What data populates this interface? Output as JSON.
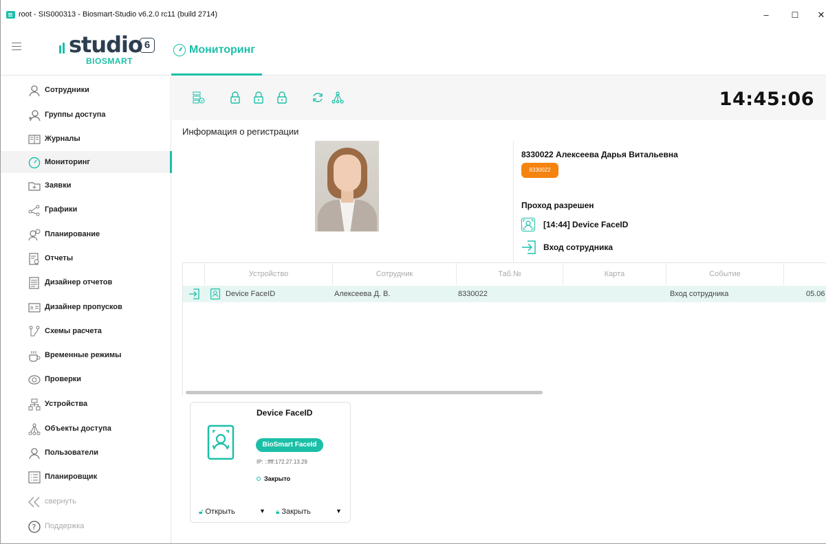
{
  "window": {
    "title": "root - SIS000313 - Biosmart-Studio v6.2.0 rc11 (build 2714)",
    "minimize": "–",
    "maximize": "☐",
    "close": "✕"
  },
  "logo": {
    "word": "studio",
    "version": "6",
    "sub": "BIOSMART"
  },
  "header": {
    "tab_label": "Мониторинг"
  },
  "sidebar": {
    "items": [
      {
        "label": "Сотрудники",
        "icon": "person-icon"
      },
      {
        "label": "Группы доступа",
        "icon": "group-icon"
      },
      {
        "label": "Журналы",
        "icon": "book-icon"
      },
      {
        "label": "Мониторинг",
        "icon": "gauge-icon",
        "active": true
      },
      {
        "label": "Заявки",
        "icon": "folder-plus-icon"
      },
      {
        "label": "Графики",
        "icon": "share-icon"
      },
      {
        "label": "Планирование",
        "icon": "person-clock-icon"
      },
      {
        "label": "Отчеты",
        "icon": "report-icon"
      },
      {
        "label": "Дизайнер отчетов",
        "icon": "report-design-icon"
      },
      {
        "label": "Дизайнер пропусков",
        "icon": "badge-design-icon"
      },
      {
        "label": "Схемы расчета",
        "icon": "flow-icon"
      },
      {
        "label": "Временные режимы",
        "icon": "cup-icon"
      },
      {
        "label": "Проверки",
        "icon": "eye-icon"
      },
      {
        "label": "Устройства",
        "icon": "network-icon"
      },
      {
        "label": "Объекты доступа",
        "icon": "nodes-icon"
      },
      {
        "label": "Пользователи",
        "icon": "user-icon"
      },
      {
        "label": "Планировщик",
        "icon": "list-icon"
      },
      {
        "label": "свернуть",
        "icon": "collapse-icon",
        "muted": true
      },
      {
        "label": "Поддержка",
        "icon": "help-icon",
        "muted": true
      }
    ]
  },
  "toolbar": {
    "time": "14:45:06"
  },
  "registration": {
    "title": "Информация о регистрации",
    "employee": "8330022 Алексеева Дарья Витальевна",
    "badge": "8330022",
    "status": "Проход разрешен",
    "device_line": "[14:44] Device FaceID",
    "event_line": "Вход сотрудника"
  },
  "table": {
    "columns": [
      "Устройство",
      "Сотрудник",
      "Таб.№",
      "Карта",
      "Событие",
      ""
    ],
    "rows": [
      {
        "device": "Device FaceID",
        "employee": "Алексеева Д. В.",
        "tab": "8330022",
        "card": "",
        "event": "Вход сотрудника",
        "date": "05.06"
      }
    ]
  },
  "device_card": {
    "name": "Device FaceID",
    "type": "BioSmart FaceId",
    "ip": "IP: ::ffff:172.27.13.29",
    "status": "Закрыто",
    "open_label": "Открыть",
    "close_label": "Закрыть"
  },
  "colors": {
    "accent": "#1bbfa8",
    "badge": "#f5830f"
  }
}
